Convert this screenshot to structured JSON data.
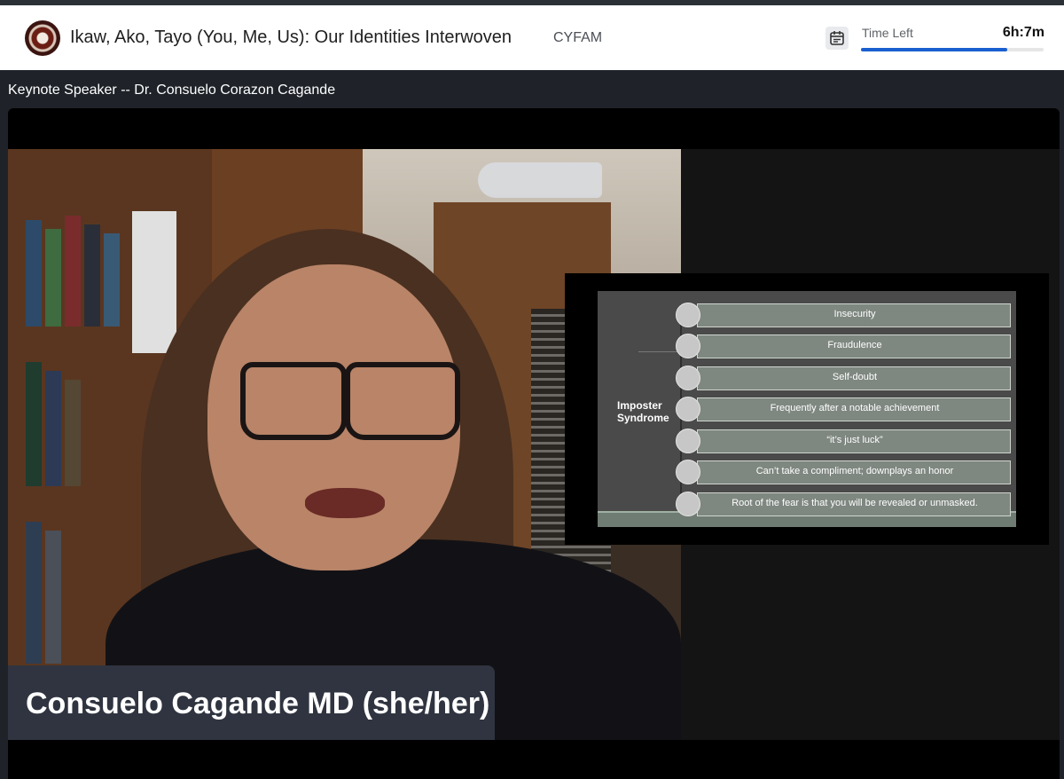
{
  "header": {
    "event_title": "Ikaw, Ako, Tayo (You, Me, Us): Our Identities Interwoven",
    "org": "CYFAM",
    "time_left_label": "Time Left",
    "time_left_value": "6h:7m",
    "time_left_progress": 0.8
  },
  "session": {
    "title": "Keynote Speaker -- Dr. Consuelo Corazon Cagande"
  },
  "video": {
    "speaker_name": "Consuelo Cagande MD (she/her)"
  },
  "slide": {
    "heading": "Imposter\nSyndrome",
    "items": [
      "Insecurity",
      "Fraudulence",
      "Self-doubt",
      "Frequently after a notable achievement",
      "“it’s just luck”",
      "Can’t take a compliment; downplays an honor",
      "Root of the fear is that you will be revealed or unmasked."
    ]
  },
  "icons": {
    "logo": "event-logo",
    "calendar": "calendar-icon"
  },
  "colors": {
    "progress": "#1a5fd0",
    "header_bg": "#ffffff",
    "page_bg": "#1f2329"
  }
}
